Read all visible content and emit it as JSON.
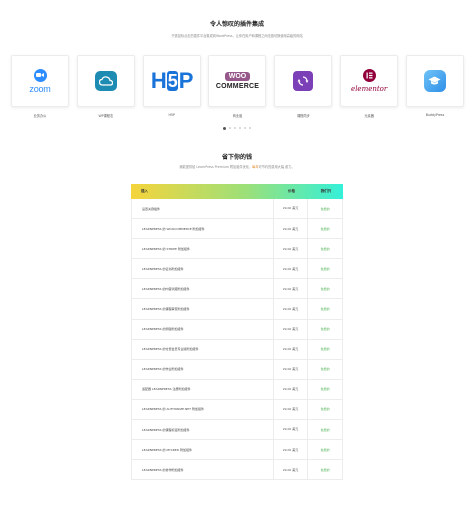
{
  "hero": {
    "title": "令人惊叹的插件集成",
    "subtitle": "只需鼠标点击的插件平台集成到WordPress，让你在用户和课程之间无缝切换使用高级的网站"
  },
  "integrations": [
    {
      "label": "业务办公",
      "icon": "zoom-logo",
      "word": "zoom"
    },
    {
      "label": "WP课程志",
      "icon": "cloud-logo"
    },
    {
      "label": "H5P",
      "icon": "h5p-logo",
      "word": "H5P"
    },
    {
      "label": "商业组",
      "icon": "woocommerce-logo",
      "word_top": "WOO",
      "word_bottom": "COMMERCE"
    },
    {
      "label": "课程同步",
      "icon": "sync-logo"
    },
    {
      "label": "元素器",
      "icon": "elementor-logo",
      "word": "elementor"
    },
    {
      "label": "BuddyPress",
      "icon": "graduation-cap-logo"
    }
  ],
  "carousel": {
    "count": 6,
    "active": 0
  },
  "section2": {
    "title": "省下你的钱",
    "subtitle_a": "我能提供给 LearnPress Premium 附加组件优化，",
    "subtitle_hl": "每年",
    "subtitle_b": "可节约的费用大幅 费力。"
  },
  "table": {
    "headers": {
      "name": "插入",
      "price": "价格",
      "status": "我们只"
    },
    "rows": [
      {
        "name": "设置关键插件",
        "price": "29.00 美元",
        "status": "免费的"
      },
      {
        "name": "LEARNPRESS 的 WOOCOMMERCE 附加组件",
        "price": "29.00 美元",
        "status": "免费的"
      },
      {
        "name": "LEARNPRESS 的 STRIPE 附加组件",
        "price": "29.00 美元",
        "status": "免费的"
      },
      {
        "name": "LEARNPRESS 的证书附加组件",
        "price": "29.00 美元",
        "status": "免费的"
      },
      {
        "name": "LEARNPRESS 的内容滴灌附加组件",
        "price": "29.00 美元",
        "status": "免费的"
      },
      {
        "name": "LEARNPRESS 的课程审查附加组件",
        "price": "29.00 美元",
        "status": "免费的"
      },
      {
        "name": "LEARNPRESS 的测验附加组件",
        "price": "29.00 美元",
        "status": "免费的"
      },
      {
        "name": "LEARNPRESS 的付费会员专业版附加组件",
        "price": "29.00 美元",
        "status": "免费的"
      },
      {
        "name": "LEARNPRESS 的作业附加组件",
        "price": "29.00 美元",
        "status": "免费的"
      },
      {
        "name": "适配器 LEARNPRESS 注册附加组件",
        "price": "29.00 美元",
        "status": "免费的"
      },
      {
        "name": "LEARNPRESS 的 AUTHORIZE.NET 附加组件",
        "price": "29.00 美元",
        "status": "免费的"
      },
      {
        "name": "LEARNPRESS 的课程标签附加组件",
        "price": "29.00 美元",
        "status": "免费的"
      },
      {
        "name": "LEARNPRESS 的 MYCRED 附加组件",
        "price": "29.00 美元",
        "status": "免费的"
      },
      {
        "name": "LEARNPRESS 的协作附加组件",
        "price": "29.00 美元",
        "status": "免费的"
      }
    ]
  },
  "colors": {
    "zoom": "#2d8cff",
    "h5p": "#1a73d9",
    "woo": "#96588a",
    "sync": "#7b3fb8",
    "elementor": "#92003b",
    "free_green": "#4caf50"
  }
}
